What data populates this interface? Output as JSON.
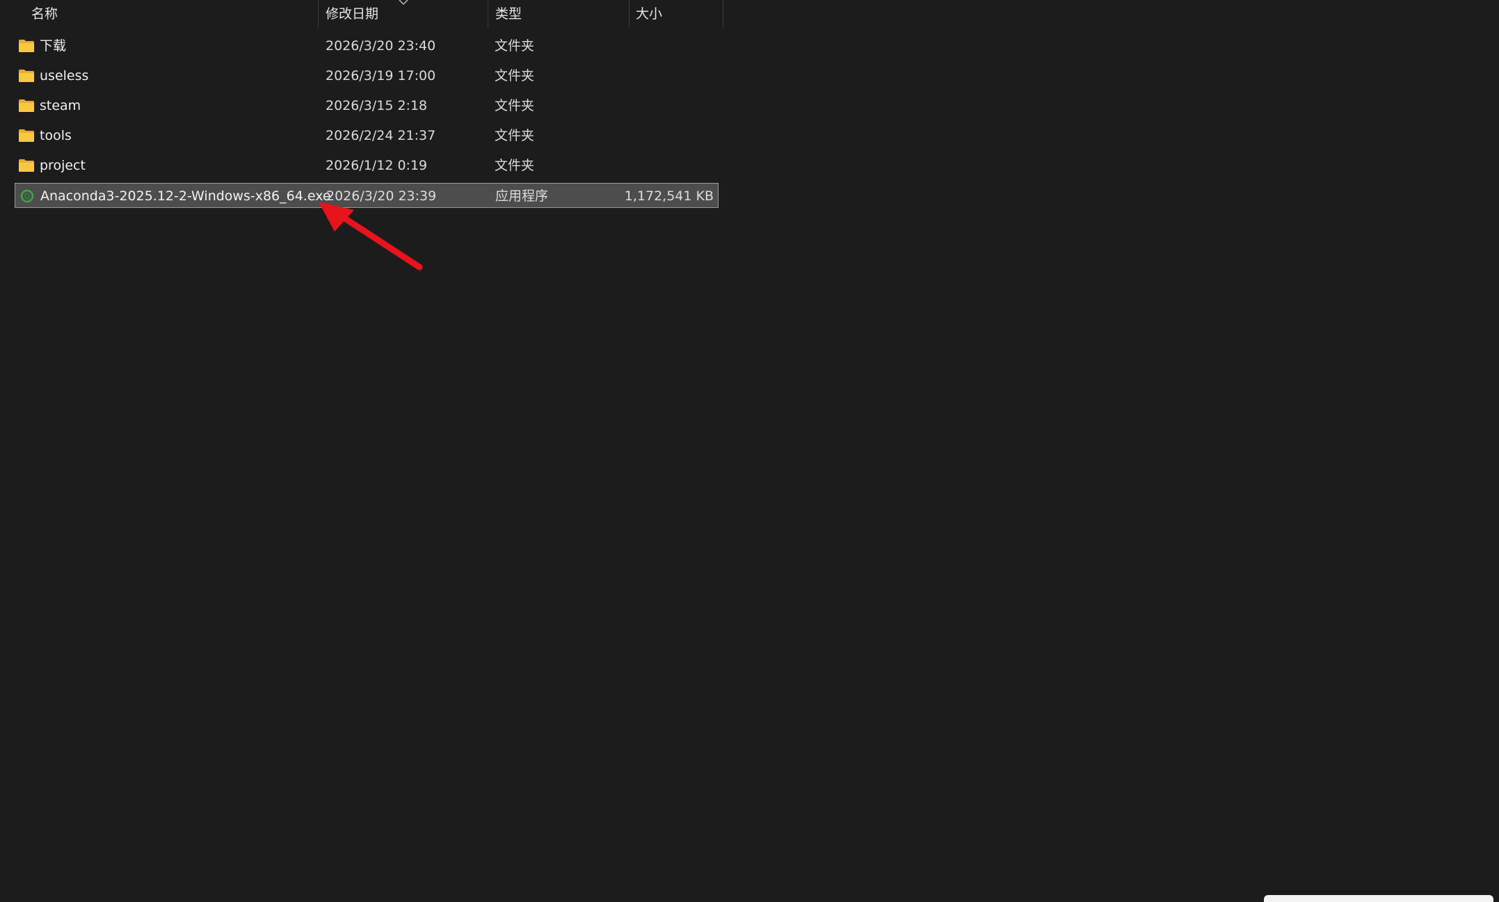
{
  "columns": {
    "name": "名称",
    "modified": "修改日期",
    "type": "类型",
    "size": "大小"
  },
  "files": [
    {
      "name": "下载",
      "modified": "2026/3/20 23:40",
      "type": "文件夹",
      "size": "",
      "icon": "folder-icon"
    },
    {
      "name": "useless",
      "modified": "2026/3/19 17:00",
      "type": "文件夹",
      "size": "",
      "icon": "folder-icon"
    },
    {
      "name": "steam",
      "modified": "2026/3/15 2:18",
      "type": "文件夹",
      "size": "",
      "icon": "folder-icon"
    },
    {
      "name": "tools",
      "modified": "2026/2/24 21:37",
      "type": "文件夹",
      "size": "",
      "icon": "folder-icon"
    },
    {
      "name": "project",
      "modified": "2026/1/12 0:19",
      "type": "文件夹",
      "size": "",
      "icon": "folder-icon"
    },
    {
      "name": "Anaconda3-2025.12-2-Windows-x86_64.exe",
      "modified": "2026/3/20 23:39",
      "type": "应用程序",
      "size": "1,172,541 KB",
      "icon": "anaconda-icon",
      "selected": true
    }
  ],
  "colors": {
    "background": "#1c1c1c",
    "selection": "#4d4d4d",
    "folder": "#f5c842",
    "annotation_arrow": "#e8141c"
  }
}
